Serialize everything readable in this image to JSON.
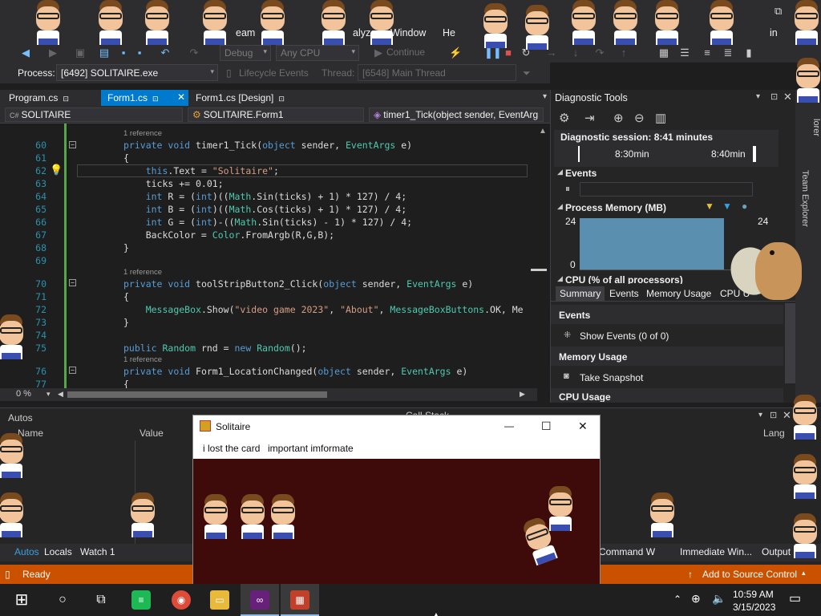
{
  "menubar": {
    "items": [
      "eam",
      "alyze",
      "Window",
      "He",
      "in"
    ],
    "window_controls": [
      "⧉",
      "✕"
    ]
  },
  "toolbar": {
    "config": "Debug",
    "platform": "Any CPU",
    "continue_label": "Continue"
  },
  "procbar": {
    "process_label": "Process:",
    "process_value": "[6492] SOLITAIRE.exe",
    "lifecycle_label": "Lifecycle Events",
    "thread_label": "Thread:",
    "thread_value": "[6548] Main Thread"
  },
  "doc_tabs": [
    {
      "label": "Program.cs",
      "pin": "⊡"
    },
    {
      "label": "Form1.cs",
      "pin": "⊡"
    },
    {
      "label": "Form1.cs [Design]",
      "pin": "⊡"
    }
  ],
  "navbar": {
    "project": "SOLITAIRE",
    "class": "SOLITAIRE.Form1",
    "member": "timer1_Tick(object sender, EventArg"
  },
  "editor": {
    "zoom": "0 %",
    "refs": [
      "1 reference",
      "1 reference",
      "1 reference"
    ],
    "lines": [
      {
        "n": "60",
        "code": "private void timer1_Tick(object sender, EventArgs e)"
      },
      {
        "n": "61",
        "code": "{"
      },
      {
        "n": "62",
        "code": "    this.Text = \"Solitaire\";"
      },
      {
        "n": "63",
        "code": "    ticks += 0.01;"
      },
      {
        "n": "64",
        "code": "    int R = (int)((Math.Sin(ticks) + 1) * 127) / 4;"
      },
      {
        "n": "65",
        "code": "    int B = (int)((Math.Cos(ticks) + 1) * 127) / 4;"
      },
      {
        "n": "66",
        "code": "    int G = (int)-((Math.Sin(ticks) - 1) * 127) / 4;"
      },
      {
        "n": "67",
        "code": "    BackColor = Color.FromArgb(R,G,B);"
      },
      {
        "n": "68",
        "code": "}"
      },
      {
        "n": "69",
        "code": ""
      },
      {
        "n": "70",
        "code": "private void toolStripButton2_Click(object sender, EventArgs e)"
      },
      {
        "n": "71",
        "code": "{"
      },
      {
        "n": "72",
        "code": "    MessageBox.Show(\"video game 2023\", \"About\", MessageBoxButtons.OK, Me"
      },
      {
        "n": "73",
        "code": "}"
      },
      {
        "n": "74",
        "code": ""
      },
      {
        "n": "75",
        "code": "public Random rnd = new Random();"
      },
      {
        "n": "76",
        "code": "private void Form1_LocationChanged(object sender, EventArgs e)"
      },
      {
        "n": "77",
        "code": "{"
      }
    ]
  },
  "diag": {
    "title": "Diagnostic Tools",
    "session": "Diagnostic session: 8:41 minutes",
    "time1": "8:30min",
    "time2": "8:40min",
    "events": "Events",
    "process_memory": "Process Memory (MB)",
    "mem_max": "24",
    "mem_max_right": "24",
    "mem_min": "0",
    "cpu": "CPU (% of all processors)",
    "tabs": [
      "Summary",
      "Events",
      "Memory Usage",
      "CPU U"
    ],
    "events_header": "Events",
    "show_events": "Show Events (0 of 0)",
    "memory_header": "Memory Usage",
    "take_snapshot": "Take Snapshot",
    "cpu_header": "CPU Usage"
  },
  "right_strip": [
    "lorer",
    "Team Explorer"
  ],
  "autos": {
    "title": "Autos",
    "col_name": "Name",
    "col_value": "Value",
    "col_lang": "Lang",
    "call_stack": "Call Stack"
  },
  "bottom_tabs": [
    "Autos",
    "Locals",
    "Watch 1",
    "Command W",
    "Immediate Win...",
    "Output"
  ],
  "status": {
    "ready": "Ready",
    "source_control": "Add to Source Control"
  },
  "solitaire": {
    "title": "Solitaire",
    "menu": [
      "i lost the card",
      "important imformate"
    ],
    "controls": [
      "—",
      "☐",
      "✕"
    ]
  },
  "taskbar": {
    "time": "10:59 AM",
    "date": "3/15/2023"
  },
  "colors": {
    "accent": "#007acc",
    "status": "#ca5100",
    "canvas": "#3e0a0a"
  }
}
